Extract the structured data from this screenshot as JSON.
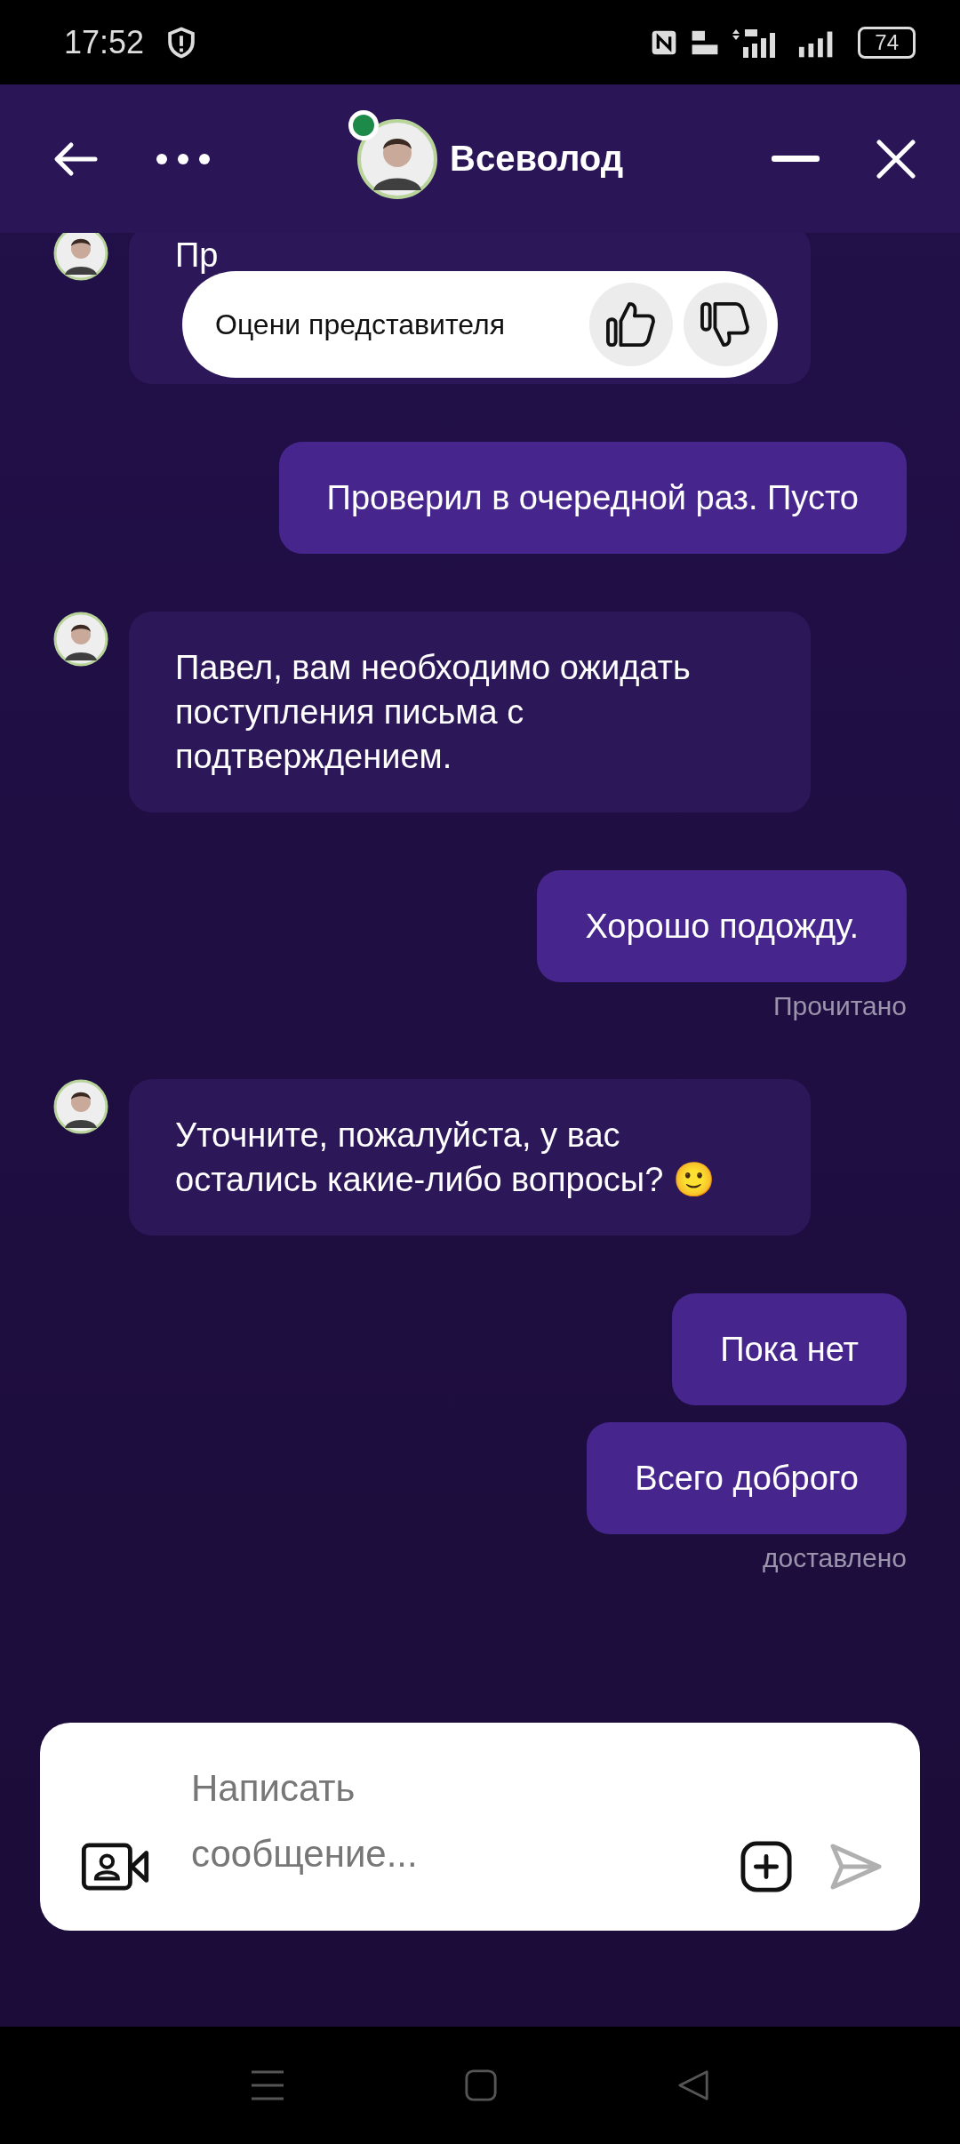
{
  "status_bar": {
    "time": "17:52",
    "battery": "74"
  },
  "header": {
    "name": "Всеволод",
    "online": true
  },
  "rating_popup": {
    "text": "Оцени представителя"
  },
  "messages": [
    {
      "kind": "agent",
      "text": "Пр"
    },
    {
      "kind": "user",
      "text": "Проверил в очередной раз. Пусто"
    },
    {
      "kind": "agent",
      "text": "Павел, вам необходимо ожидать поступления письма с подтверждением."
    },
    {
      "kind": "user",
      "text": "Хорошо подожду.",
      "status": "Прочитано"
    },
    {
      "kind": "agent",
      "text": "Уточните, пожалуйста, у вас остались какие-либо вопросы? 🙂"
    },
    {
      "kind": "user",
      "text": "Пока нет"
    },
    {
      "kind": "user",
      "text": "Всего доброго",
      "status": "доставлено"
    }
  ],
  "composer": {
    "placeholder": "Написать сообщение..."
  }
}
